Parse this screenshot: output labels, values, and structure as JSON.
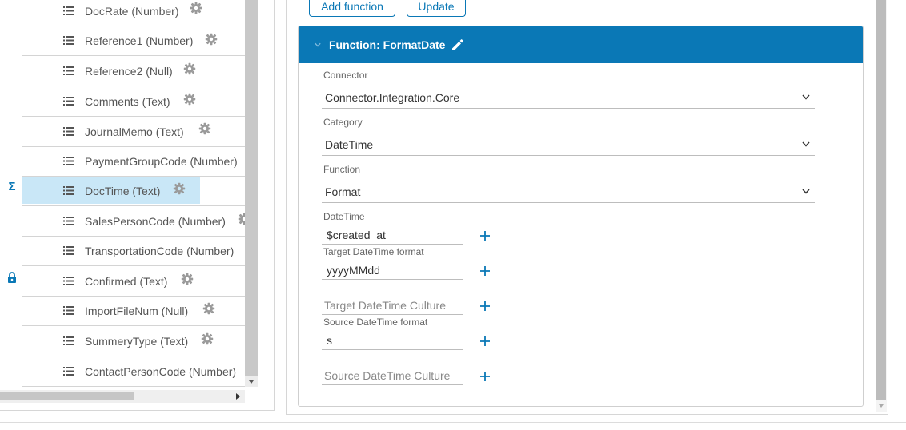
{
  "fields": [
    {
      "label": "DocRate (Number)",
      "gear": true
    },
    {
      "label": "Reference1 (Number)",
      "gear": true
    },
    {
      "label": "Reference2 (Null)",
      "gear": true
    },
    {
      "label": "Comments (Text)",
      "gear": true
    },
    {
      "label": "JournalMemo (Text)",
      "gear": true
    },
    {
      "label": "PaymentGroupCode (Number)",
      "gear": false
    },
    {
      "label": "DocTime (Text)",
      "gear": true,
      "selected": true,
      "marker": "Σ"
    },
    {
      "label": "SalesPersonCode (Number)",
      "gear": true
    },
    {
      "label": "TransportationCode (Number)",
      "gear": false
    },
    {
      "label": "Confirmed (Text)",
      "gear": true,
      "marker": "lock"
    },
    {
      "label": "ImportFileNum (Null)",
      "gear": true
    },
    {
      "label": "SummeryType (Text)",
      "gear": true
    },
    {
      "label": "ContactPersonCode (Number)",
      "gear": false
    }
  ],
  "toolbar": {
    "add_function_label": "Add function",
    "update_label": "Update"
  },
  "function_card": {
    "title": "Function: FormatDate",
    "connector": {
      "caption": "Connector",
      "value": "Connector.Integration.Core"
    },
    "category": {
      "caption": "Category",
      "value": "DateTime"
    },
    "function": {
      "caption": "Function",
      "value": "Format"
    },
    "params": [
      {
        "caption": "DateTime",
        "value": "$created_at",
        "placeholder": ""
      },
      {
        "caption": "Target DateTime format",
        "value": "yyyyMMdd",
        "placeholder": ""
      },
      {
        "caption": "",
        "value": "",
        "placeholder": "Target DateTime Culture"
      },
      {
        "caption": "Source DateTime format",
        "value": "s",
        "placeholder": ""
      },
      {
        "caption": "",
        "value": "",
        "placeholder": "Source DateTime Culture"
      }
    ]
  },
  "colors": {
    "accent": "#0a78b6",
    "selected_row": "#c9e7f7",
    "icon_gray": "#9a9a9a"
  }
}
